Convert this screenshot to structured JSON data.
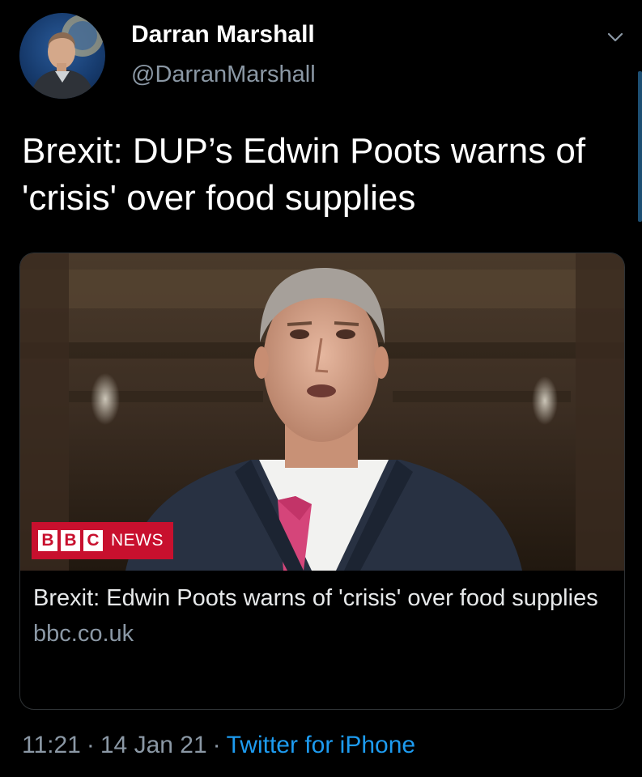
{
  "author": {
    "display_name": "Darran Marshall",
    "handle": "@DarranMarshall"
  },
  "icons": {
    "avatar": "profile-photo",
    "menu": "chevron-down-icon"
  },
  "tweet": {
    "text": "Brexit: DUP’s Edwin Poots warns of 'crisis' over food supplies"
  },
  "link_card": {
    "image_badge": {
      "letters": [
        "B",
        "B",
        "C"
      ],
      "label": "NEWS"
    },
    "title": "Brexit: Edwin Poots warns of 'crisis' over food supplies",
    "domain": "bbc.co.uk"
  },
  "meta": {
    "time": "11:21",
    "date": "14 Jan 21",
    "separator": "·",
    "source": "Twitter for iPhone"
  },
  "colors": {
    "background": "#000000",
    "text_primary": "#ffffff",
    "text_secondary": "#8b98a5",
    "link": "#1d9bf0",
    "bbc_red": "#c8102e"
  }
}
